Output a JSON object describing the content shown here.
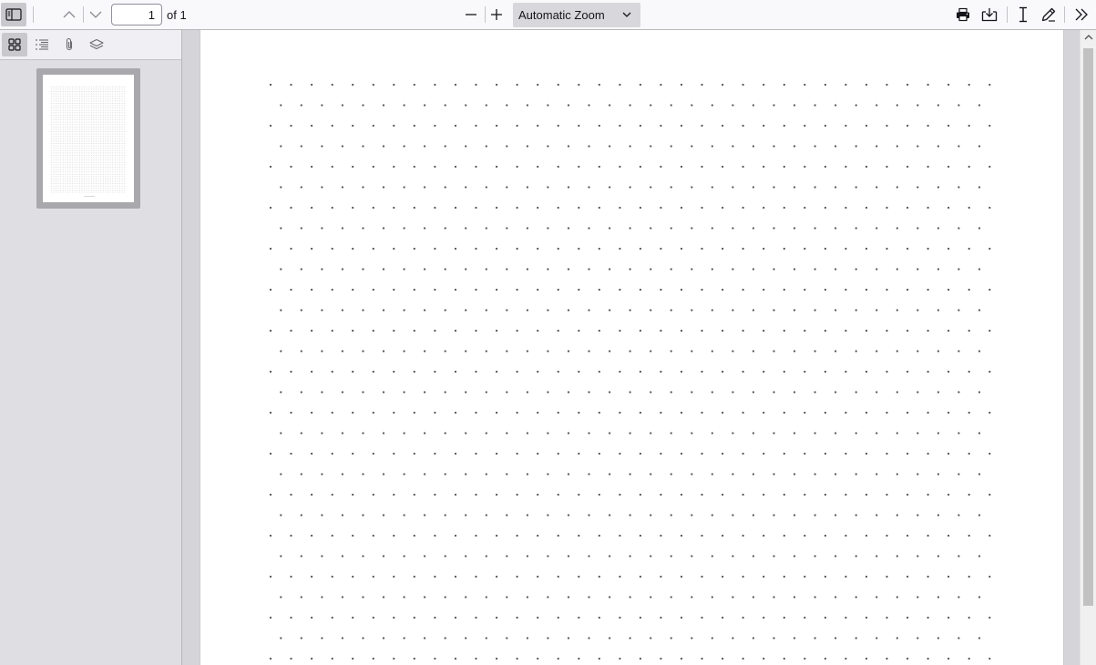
{
  "toolbar": {
    "sidebar_toggle_icon": "sidebar-toggle-icon",
    "previous_page_icon": "chevron-up-icon",
    "next_page_icon": "chevron-down-icon",
    "page_number": "1",
    "page_of": "of 1",
    "zoom_out_icon": "minus-icon",
    "zoom_in_icon": "plus-icon",
    "zoom_value": "Automatic Zoom",
    "print_icon": "print-icon",
    "save_icon": "save-icon",
    "text_tool_icon": "text-cursor-icon",
    "draw_tool_icon": "pen-icon",
    "tools_menu_icon": "double-chevron-right-icon"
  },
  "sidebar": {
    "views": [
      {
        "icon": "thumbnails-icon",
        "active": true
      },
      {
        "icon": "outline-icon",
        "active": false
      },
      {
        "icon": "attachments-icon",
        "active": false
      },
      {
        "icon": "layers-icon",
        "active": false
      }
    ],
    "thumbnails": [
      {
        "page": 1,
        "selected": true
      }
    ]
  },
  "document": {
    "total_pages": 1,
    "content": "dot-grid",
    "dot_color": "#555555"
  },
  "colors": {
    "toolbar_bg": "#f9f9fb",
    "sidebar_bg": "#dfdfe3",
    "viewer_bg": "#d4d4d9",
    "page_bg": "#ffffff",
    "toggled_bg": "#c9c9cd"
  }
}
